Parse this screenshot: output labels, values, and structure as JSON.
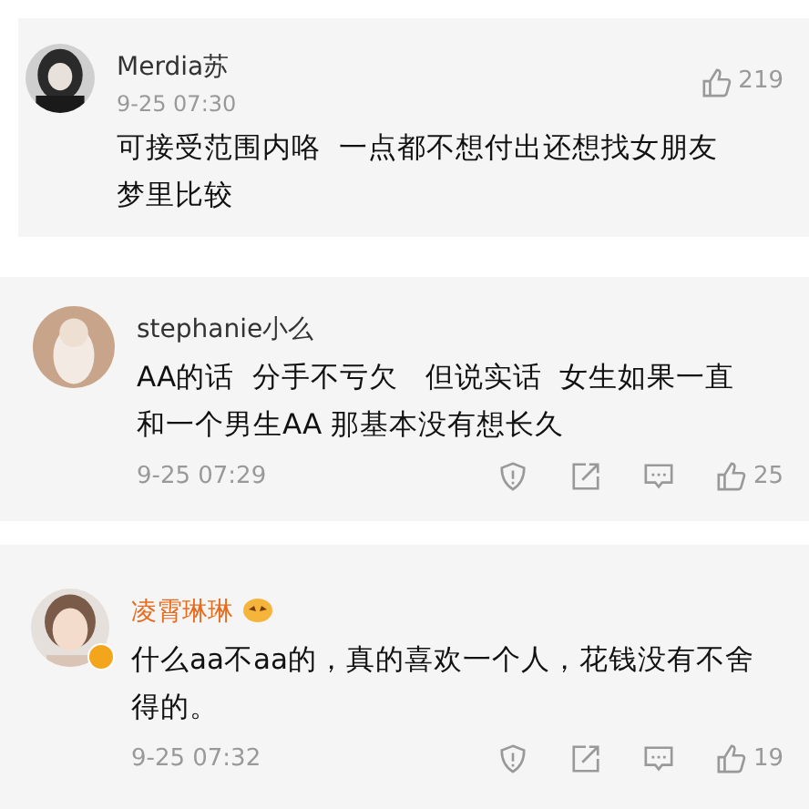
{
  "comments": [
    {
      "user": "Merdia苏",
      "vip": false,
      "time": "9-25 07:30",
      "text": "可接受范围内咯  一点都不想付出还想找女朋友梦里比较",
      "likes": "219",
      "kind": "top"
    },
    {
      "user": "stephanie小么",
      "vip": false,
      "time": "9-25 07:29",
      "text": "AA的话  分手不亏欠   但说实话  女生如果一直和一个男生AA 那基本没有想长久",
      "likes": "25",
      "kind": "bottom"
    },
    {
      "user": "凌霄琳琳",
      "vip": true,
      "time": "9-25 07:32",
      "text": "什么aa不aa的，真的喜欢一个人，花钱没有不舍得的。",
      "likes": "19",
      "kind": "bottom"
    }
  ]
}
